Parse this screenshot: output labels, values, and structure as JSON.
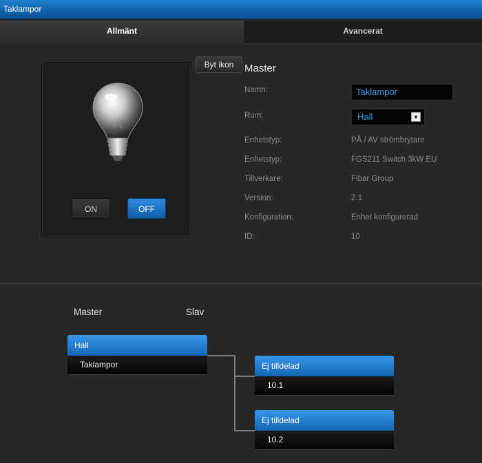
{
  "window": {
    "title": "Taklampor"
  },
  "tabs": [
    {
      "label": "Allmänt",
      "active": true
    },
    {
      "label": "Avancerat",
      "active": false
    }
  ],
  "device": {
    "icon": "lightbulb-icon",
    "change_icon_label": "Byt ikon",
    "on_label": "ON",
    "off_label": "OFF",
    "state": "OFF"
  },
  "info": {
    "title": "Master",
    "name_label": "Namn:",
    "name_value": "Taklampor",
    "room_label": "Rum:",
    "room_value": "Hall",
    "rows": [
      {
        "label": "Enhetstyp:",
        "value": "PÅ / AV strömbrytare"
      },
      {
        "label": "Enhetstyp:",
        "value": "FGS211 Switch 3kW EU"
      },
      {
        "label": "Tillverkare:",
        "value": "Fibar Group"
      },
      {
        "label": "Version:",
        "value": "2.1"
      },
      {
        "label": "Konfiguration:",
        "value": "Enhet konfigurerad"
      },
      {
        "label": "ID:",
        "value": "10"
      }
    ]
  },
  "association": {
    "master_label": "Master",
    "slave_label": "Slav",
    "master": {
      "room": "Hall",
      "device": "Taklampor"
    },
    "slaves": [
      {
        "room": "Ej tilldelad",
        "device": "10.1"
      },
      {
        "room": "Ej tilldelad",
        "device": "10.2"
      }
    ]
  },
  "colors": {
    "accent": "#2a80d6",
    "link_text": "#3d98e8",
    "background": "#272727"
  }
}
